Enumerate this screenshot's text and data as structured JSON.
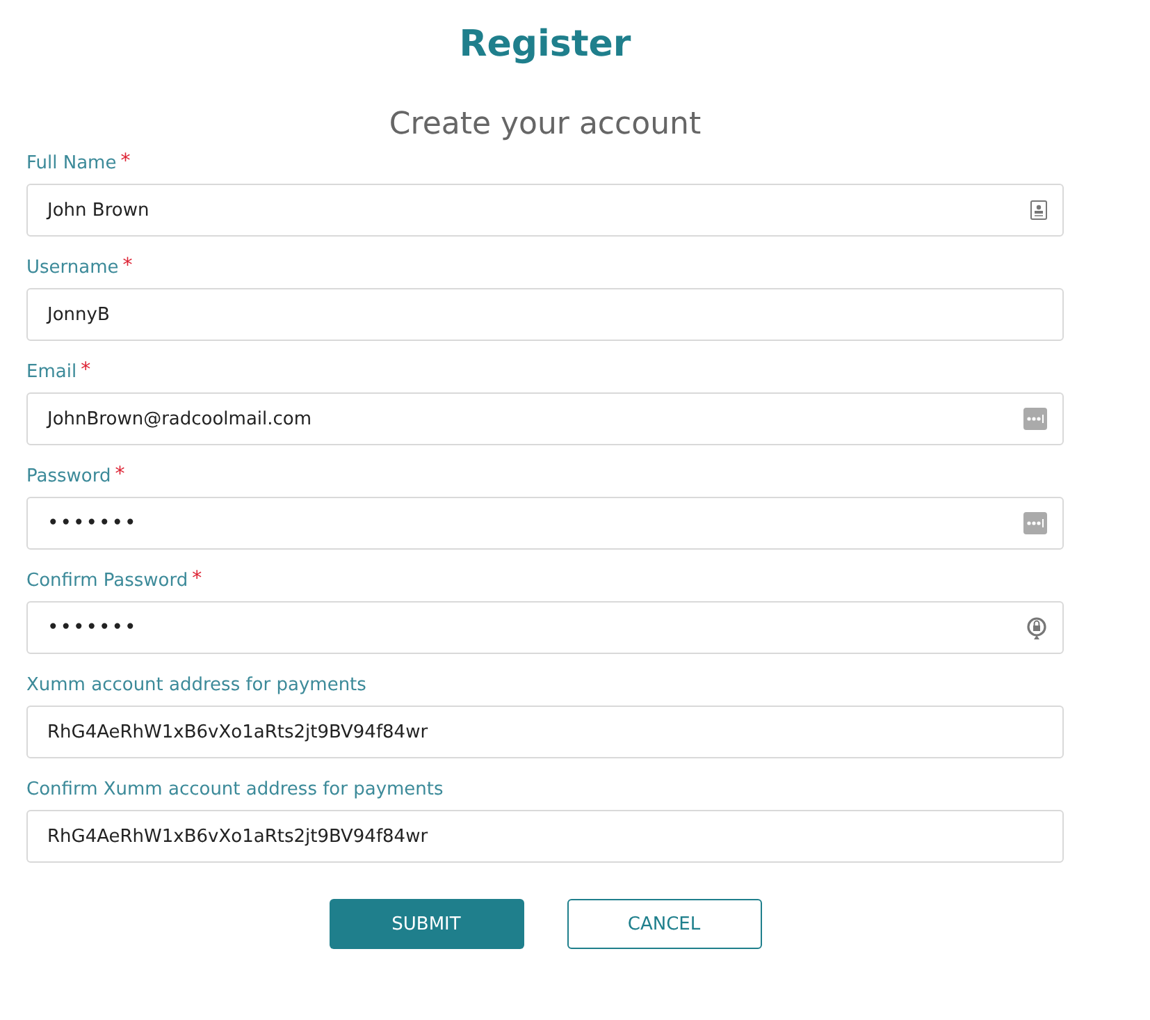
{
  "title": "Register",
  "subtitle": "Create your account",
  "fields": [
    {
      "label": "Full Name",
      "mark": "*",
      "value": "John Brown",
      "kind": "contact"
    },
    {
      "label": "Username",
      "mark": "*",
      "value": "JonnyB",
      "kind": "plain"
    },
    {
      "label": "Email",
      "mark": "*",
      "value": "JohnBrown@radcoolmail.com",
      "kind": "autofill"
    },
    {
      "label": "Password",
      "mark": "*",
      "value": "•••••••",
      "kind": "autofill"
    },
    {
      "label": "Confirm Password",
      "mark": "*",
      "value": "•••••••",
      "kind": "lock"
    },
    {
      "label": "Xumm account address for payments",
      "value": "RhG4AeRhW1xB6vXo1aRts2jt9BV94f84wr",
      "kind": "plain"
    },
    {
      "label": "Confirm Xumm account address for payments",
      "value": "RhG4AeRhW1xB6vXo1aRts2jt9BV94f84wr",
      "kind": "plain"
    }
  ],
  "buttons": [
    {
      "label": "SUBMIT",
      "kind": "primary"
    },
    {
      "label": "CANCEL",
      "kind": "outline"
    }
  ]
}
